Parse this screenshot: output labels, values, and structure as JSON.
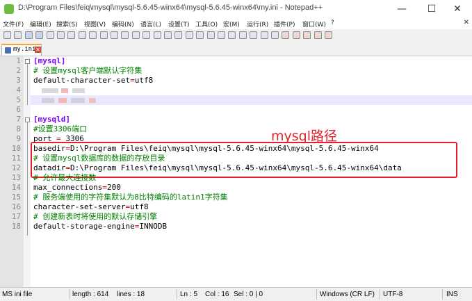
{
  "window": {
    "title": "D:\\Program Files\\feiq\\mysql\\mysql-5.6.45-winx64\\mysql-5.6.45-winx64\\my.ini - Notepad++",
    "minimize_glyph": "—",
    "maximize_glyph": "☐",
    "close_glyph": "✕"
  },
  "menu": {
    "items": [
      "文件(F)",
      "编辑(E)",
      "搜索(S)",
      "视图(V)",
      "编码(N)",
      "语言(L)",
      "设置(T)",
      "工具(O)",
      "宏(M)",
      "运行(R)",
      "插件(P)",
      "窗口(W)",
      "?"
    ],
    "close_glyph": "✕"
  },
  "toolbar": {
    "icons": [
      "new-file",
      "open-file",
      "save",
      "save-all",
      "close",
      "close-all",
      "print",
      "cut",
      "copy",
      "paste",
      "undo",
      "redo",
      "find",
      "replace",
      "zoom-in",
      "zoom-out",
      "sync-vertical",
      "sync-horizontal",
      "word-wrap",
      "show-all-chars",
      "indent-guide",
      "user-defined-language",
      "doc-map",
      "function-list",
      "folder-as-workspace",
      "monitor",
      "record-macro",
      "stop-record",
      "playback-macro",
      "run-macro-multiple",
      "save-macro"
    ]
  },
  "tab": {
    "label": "my.ini",
    "close_glyph": "✕"
  },
  "editor": {
    "lines": [
      {
        "n": "1",
        "parts": [
          {
            "t": "[mysql]",
            "c": "t-sec"
          }
        ]
      },
      {
        "n": "2",
        "parts": [
          {
            "t": "# 设置mysql客户端默认字符集",
            "c": "t-cmt"
          }
        ]
      },
      {
        "n": "3",
        "parts": [
          {
            "t": "default-character-set",
            "c": "t-key"
          },
          {
            "t": "=",
            "c": "t-op"
          },
          {
            "t": "utf8",
            "c": "t-key"
          }
        ]
      },
      {
        "n": "4",
        "parts": []
      },
      {
        "n": "5",
        "parts": []
      },
      {
        "n": "6",
        "parts": []
      },
      {
        "n": "7",
        "parts": [
          {
            "t": "[mysqld]",
            "c": "t-sec"
          }
        ]
      },
      {
        "n": "8",
        "parts": [
          {
            "t": "#设置3306端口",
            "c": "t-cmt"
          }
        ]
      },
      {
        "n": "9",
        "parts": [
          {
            "t": "port ",
            "c": "t-key"
          },
          {
            "t": "=",
            "c": "t-op"
          },
          {
            "t": " 3306",
            "c": "t-key"
          }
        ]
      },
      {
        "n": "10",
        "parts": [
          {
            "t": "basedir",
            "c": "t-key"
          },
          {
            "t": "=",
            "c": "t-op"
          },
          {
            "t": "D:\\Program Files\\feiq\\mysql\\mysql-5.6.45-winx64\\mysql-5.6.45-winx64",
            "c": "t-key"
          }
        ]
      },
      {
        "n": "11",
        "parts": [
          {
            "t": "# 设置mysql数据库的数据的存放目录",
            "c": "t-cmt"
          }
        ]
      },
      {
        "n": "12",
        "parts": [
          {
            "t": "datadir",
            "c": "t-key"
          },
          {
            "t": "=",
            "c": "t-op"
          },
          {
            "t": "D:\\Program Files\\feiq\\mysql\\mysql-5.6.45-winx64\\mysql-5.6.45-winx64\\data",
            "c": "t-key"
          }
        ]
      },
      {
        "n": "13",
        "parts": [
          {
            "t": "# 允许最大连接数",
            "c": "t-cmt"
          }
        ]
      },
      {
        "n": "14",
        "parts": [
          {
            "t": "max_connections",
            "c": "t-key"
          },
          {
            "t": "=",
            "c": "t-op"
          },
          {
            "t": "200",
            "c": "t-key"
          }
        ]
      },
      {
        "n": "15",
        "parts": [
          {
            "t": "# 服务端使用的字符集默认为8比特编码的latin1字符集",
            "c": "t-cmt"
          }
        ]
      },
      {
        "n": "16",
        "parts": [
          {
            "t": "character-set-server",
            "c": "t-key"
          },
          {
            "t": "=",
            "c": "t-op"
          },
          {
            "t": "utf8",
            "c": "t-key"
          }
        ]
      },
      {
        "n": "17",
        "parts": [
          {
            "t": "# 创建新表时将使用的默认存储引擎",
            "c": "t-cmt"
          }
        ]
      },
      {
        "n": "18",
        "parts": [
          {
            "t": "default-storage-engine",
            "c": "t-key"
          },
          {
            "t": "=",
            "c": "t-op"
          },
          {
            "t": "INNODB",
            "c": "t-key"
          }
        ]
      }
    ],
    "current_line": "5",
    "fold_lines": [
      "1",
      "7"
    ]
  },
  "annotation": {
    "label": "mysql路径",
    "color": "#e0202a"
  },
  "status": {
    "file_type": "MS ini file",
    "length": "length : 614",
    "lines": "lines : 18",
    "ln": "Ln : 5",
    "col": "Col : 16",
    "sel": "Sel : 0 | 0",
    "eol": "Windows (CR LF)",
    "encoding": "UTF-8",
    "mode": "INS"
  }
}
